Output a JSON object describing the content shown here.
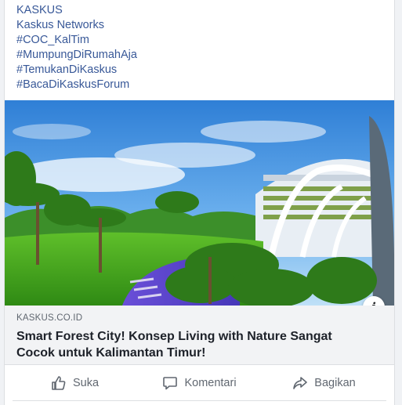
{
  "post": {
    "links": [
      "KASKUS",
      "Kaskus Networks",
      "#COC_KalTim",
      "#MumpungDiRumahAja",
      "#TemukanDiKaskus",
      "#BacaDiKaskusForum"
    ]
  },
  "link_preview": {
    "domain": "KASKUS.CO.ID",
    "title": "Smart Forest City! Konsep Living with Nature Sangat Cocok untuk Kalimantan Timur!",
    "info_icon": "info-icon"
  },
  "actions": {
    "like": "Suka",
    "comment": "Komentari",
    "share": "Bagikan"
  },
  "colors": {
    "link": "#385898",
    "muted": "#606770",
    "title": "#1d2129"
  }
}
